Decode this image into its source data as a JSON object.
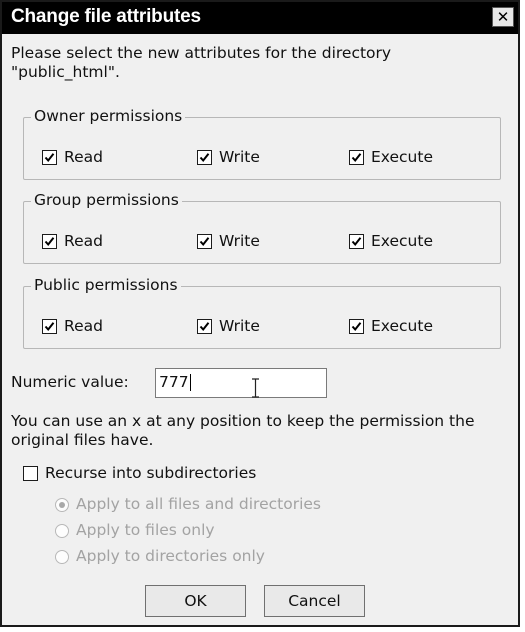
{
  "dialog": {
    "title": "Change file attributes",
    "close_glyph": "✕",
    "instructions_line1": "Please select the new attributes for the directory",
    "instructions_line2": "\"public_html\".",
    "groups": [
      {
        "legend": "Owner permissions",
        "read": {
          "label": "Read",
          "checked": true
        },
        "write": {
          "label": "Write",
          "checked": true
        },
        "execute": {
          "label": "Execute",
          "checked": true
        }
      },
      {
        "legend": "Group permissions",
        "read": {
          "label": "Read",
          "checked": true
        },
        "write": {
          "label": "Write",
          "checked": true
        },
        "execute": {
          "label": "Execute",
          "checked": true
        }
      },
      {
        "legend": "Public permissions",
        "read": {
          "label": "Read",
          "checked": true
        },
        "write": {
          "label": "Write",
          "checked": true
        },
        "execute": {
          "label": "Execute",
          "checked": true
        }
      }
    ],
    "numeric_label": "Numeric value:",
    "numeric_value": "777",
    "hint_line1": "You can use an x at any position to keep the permission the",
    "hint_line2": "original files have.",
    "recurse": {
      "label": "Recurse into subdirectories",
      "checked": false
    },
    "radios": [
      {
        "label": "Apply to all files and directories",
        "selected": true,
        "disabled": true
      },
      {
        "label": "Apply to files only",
        "selected": false,
        "disabled": true
      },
      {
        "label": "Apply to directories only",
        "selected": false,
        "disabled": true
      }
    ],
    "ok_label": "OK",
    "cancel_label": "Cancel"
  },
  "colors": {
    "titlebar": "#000000",
    "dialog_bg": "#f0f0f0",
    "disabled_text": "#a3a3a3"
  }
}
